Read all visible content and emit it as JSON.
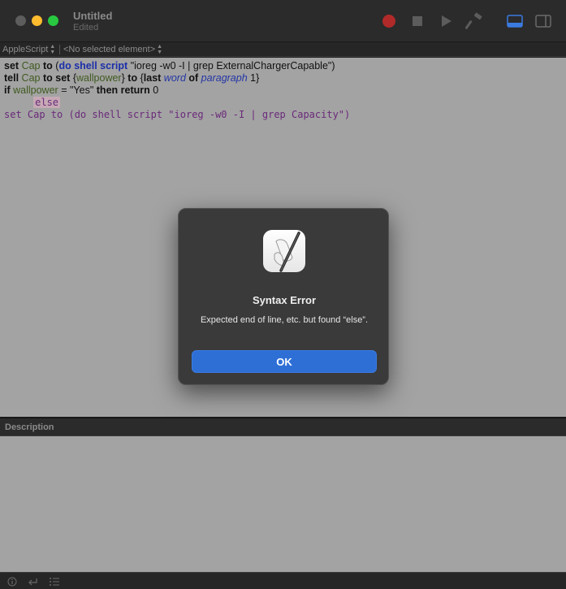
{
  "window": {
    "title": "Untitled",
    "subtitle": "Edited"
  },
  "toolbar": {
    "icons": [
      "record-icon",
      "stop-icon",
      "run-icon",
      "compile-icon",
      "bottom-panel-icon",
      "sidebar-icon"
    ],
    "record_color": "#c42b2b"
  },
  "navbar": {
    "language": "AppleScript",
    "element": "<No selected element>"
  },
  "code": {
    "line1": {
      "set": "set",
      "cap": "Cap",
      "to": "to",
      "open": "(",
      "do_shell_script": "do shell script",
      "string": "\"ioreg -w0 -I | grep ExternalChargerCapable\"",
      "close": ")"
    },
    "line2": {
      "tell": "tell",
      "cap": "Cap",
      "to": "to",
      "set": "set",
      "brace_open": "{",
      "wallpower": "wallpower",
      "brace_close": "}",
      "to2": "to",
      "brace_open2": "{",
      "last": "last",
      "word": "word",
      "of": "of",
      "paragraph": "paragraph",
      "num": "1",
      "brace_close2": "}"
    },
    "line3": {
      "if": "if",
      "wallpower": "wallpower",
      "eq": "=",
      "yes": "\"Yes\"",
      "then": "then",
      "return": "return",
      "zero": "0"
    },
    "line4": {
      "indent": "     ",
      "else": "else"
    },
    "line5": {
      "text": "set Cap to (do shell script \"ioreg -w0 -I | grep Capacity\")"
    }
  },
  "dialog": {
    "title": "Syntax Error",
    "message": "Expected end of line, etc. but found “else”.",
    "ok_label": "OK",
    "icon": "script-editor-app-icon"
  },
  "description": {
    "label": "Description"
  },
  "bottombar": {
    "icons": [
      "info-icon",
      "reply-icon",
      "list-icon"
    ]
  },
  "colors": {
    "editor_bg": "#a3a3a3",
    "accent": "#2e6fd6",
    "error_highlight": "#c6a9b5"
  }
}
